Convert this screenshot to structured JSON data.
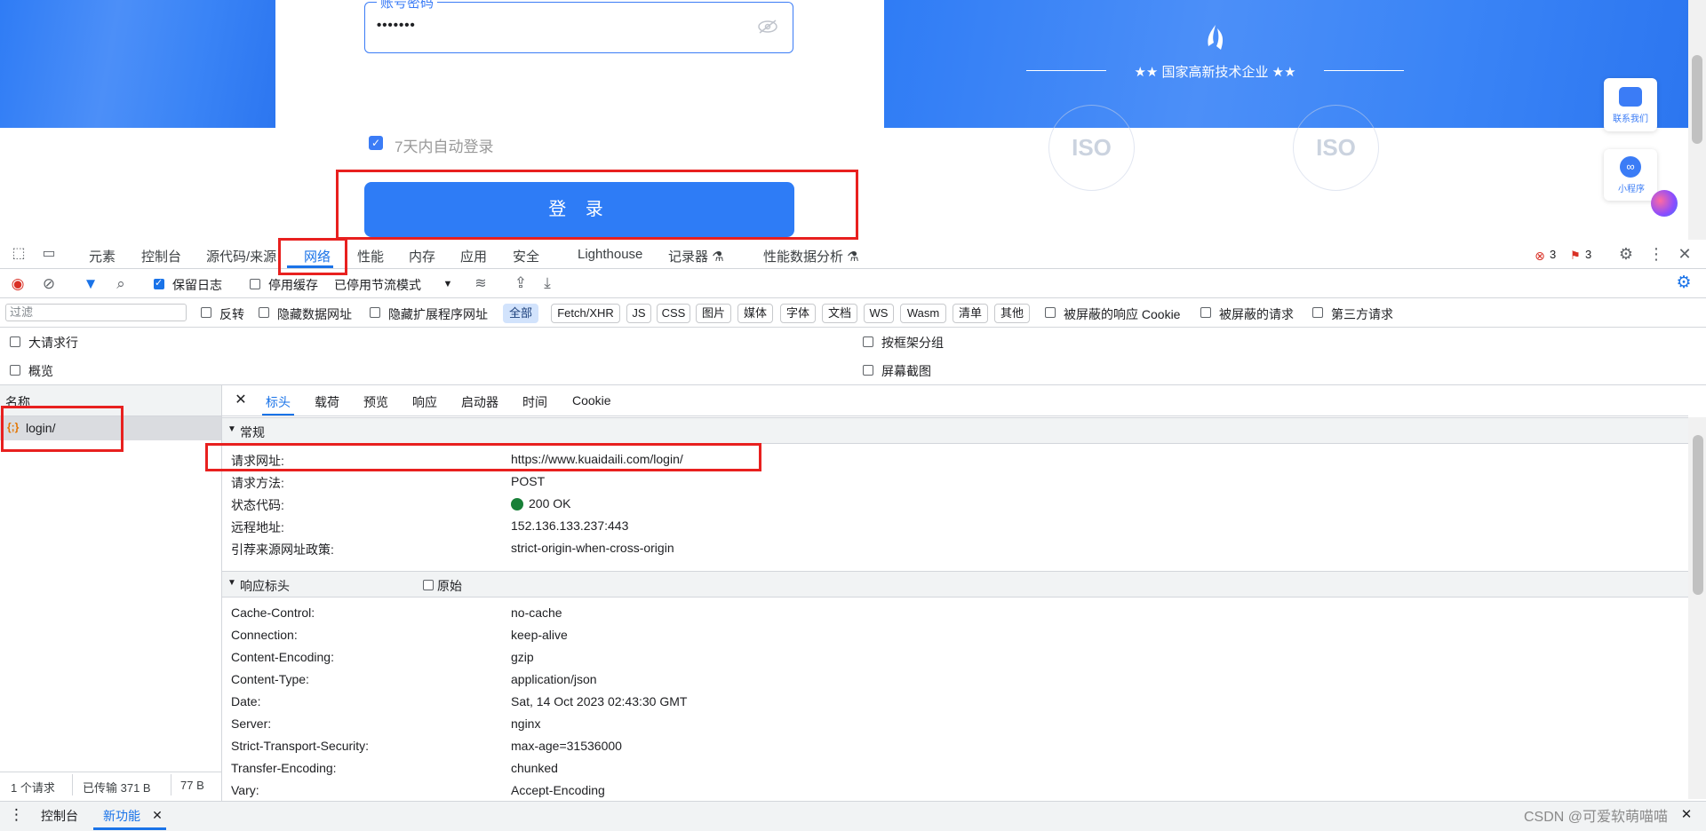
{
  "page": {
    "password_legend": "账号密码",
    "password_mask": "•••••••",
    "remember_label": "7天内自动登录",
    "login_button": "登 录",
    "tagline": "★★  国家高新技术企业  ★★",
    "iso_text": "ISO",
    "contact_label": "联系我们",
    "mini_label": "小程序"
  },
  "devtools": {
    "tabs": [
      "元素",
      "控制台",
      "源代码/来源",
      "网络",
      "性能",
      "内存",
      "应用",
      "安全",
      "Lighthouse",
      "记录器 ⚗",
      "性能数据分析 ⚗"
    ],
    "error_count": "3",
    "warning_count": "3",
    "toolbar": {
      "preserve_log": "保留日志",
      "disable_cache": "停用缓存",
      "throttle": "已停用节流模式"
    },
    "filter": {
      "placeholder": "过滤",
      "invert": "反转",
      "hide_data_urls": "隐藏数据网址",
      "hide_ext_urls": "隐藏扩展程序网址",
      "chips": [
        "全部",
        "Fetch/XHR",
        "JS",
        "CSS",
        "图片",
        "媒体",
        "字体",
        "文档",
        "WS",
        "Wasm",
        "清单",
        "其他"
      ],
      "blocked_cookies": "被屏蔽的响应 Cookie",
      "blocked_requests": "被屏蔽的请求",
      "third_party": "第三方请求"
    },
    "options": {
      "big_rows": "大请求行",
      "overview": "概览",
      "group_by_frame": "按框架分组",
      "screenshots": "屏幕截图"
    },
    "requests": {
      "header": "名称",
      "rows": [
        {
          "name": "login/"
        }
      ],
      "status": [
        "1 个请求",
        "已传输 371 B",
        "77 B"
      ]
    },
    "detail_tabs": [
      "标头",
      "载荷",
      "预览",
      "响应",
      "启动器",
      "时间",
      "Cookie"
    ],
    "general": {
      "title": "常规",
      "rows": [
        {
          "k": "请求网址:",
          "v": "https://www.kuaidaili.com/login/"
        },
        {
          "k": "请求方法:",
          "v": "POST"
        },
        {
          "k": "状态代码:",
          "v": "200 OK"
        },
        {
          "k": "远程地址:",
          "v": "152.136.133.237:443"
        },
        {
          "k": "引荐来源网址政策:",
          "v": "strict-origin-when-cross-origin"
        }
      ]
    },
    "response_headers": {
      "title": "响应标头",
      "raw_label": "原始",
      "rows": [
        {
          "k": "Cache-Control:",
          "v": "no-cache"
        },
        {
          "k": "Connection:",
          "v": "keep-alive"
        },
        {
          "k": "Content-Encoding:",
          "v": "gzip"
        },
        {
          "k": "Content-Type:",
          "v": "application/json"
        },
        {
          "k": "Date:",
          "v": "Sat, 14 Oct 2023 02:43:30 GMT"
        },
        {
          "k": "Server:",
          "v": "nginx"
        },
        {
          "k": "Strict-Transport-Security:",
          "v": "max-age=31536000"
        },
        {
          "k": "Transfer-Encoding:",
          "v": "chunked"
        },
        {
          "k": "Vary:",
          "v": "Accept-Encoding"
        }
      ]
    },
    "drawer": {
      "tabs": [
        "控制台",
        "新功能"
      ]
    }
  },
  "watermark": "CSDN @可爱软萌喵喵",
  "colors": {
    "accent": "#1a73e8",
    "highlight": "#e8201f",
    "brand_blue": "#2e7cf6"
  }
}
